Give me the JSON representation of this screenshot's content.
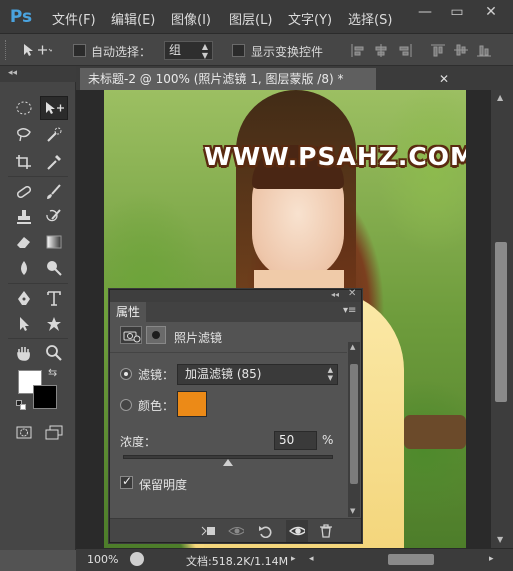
{
  "app": {
    "logo": "Ps"
  },
  "menu": [
    "文件(F)",
    "编辑(E)",
    "图像(I)",
    "图层(L)",
    "文字(Y)",
    "选择(S)"
  ],
  "window_controls": {
    "minimize": "—",
    "restore": "▭",
    "close": "✕"
  },
  "options": {
    "auto_select_label": "自动选择：",
    "auto_select_value": "组",
    "show_transform_label": "显示变换控件"
  },
  "document": {
    "tab_title": "未标题-2 @ 100% (照片滤镜 1, 图层蒙版 /8) *",
    "watermark": "WWW.PSAHZ.COM"
  },
  "status": {
    "zoom": "100%",
    "doc_info": "文档:518.2K/1.14M"
  },
  "properties": {
    "tab_label": "属性",
    "adjustment_title": "照片滤镜",
    "filter_label": "滤镜：",
    "filter_value": "加温滤镜 (85)",
    "color_label": "颜色：",
    "color_value": "#ec8a17",
    "density_label": "浓度：",
    "density_value": "50",
    "density_unit": "%",
    "density_fraction": 0.5,
    "preserve_luminosity_label": "保留明度",
    "preserve_luminosity_checked": true
  },
  "colors": {
    "foreground": "#ffffff",
    "background": "#000000"
  }
}
